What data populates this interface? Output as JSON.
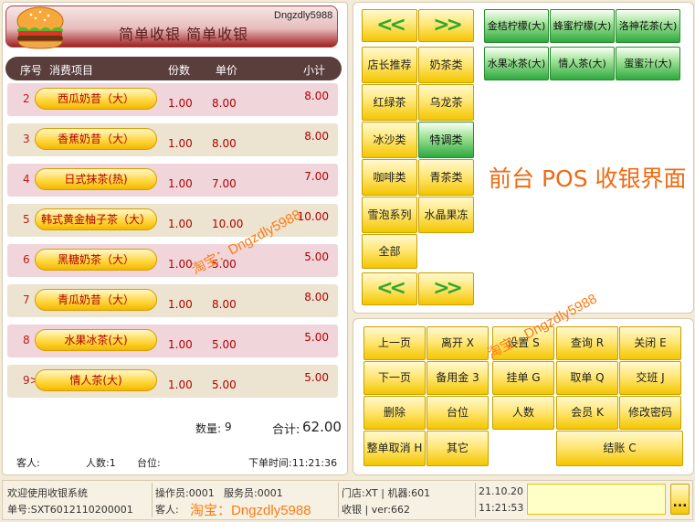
{
  "header": {
    "title": "简单收银  简单收银",
    "brand_tag": "Dngzdly5988",
    "logo_icon": "burger-icon"
  },
  "columns": {
    "no": "序号",
    "item": "消费项目",
    "qty": "份数",
    "price": "单价",
    "subtotal": "小计"
  },
  "order_items": [
    {
      "no": "2",
      "name": "西瓜奶昔（大）",
      "qty": "1.00",
      "price": "8.00",
      "subtotal": "8.00"
    },
    {
      "no": "3",
      "name": "香蕉奶昔（大）",
      "qty": "1.00",
      "price": "8.00",
      "subtotal": "8.00"
    },
    {
      "no": "4",
      "name": "日式抹茶(热)",
      "qty": "1.00",
      "price": "7.00",
      "subtotal": "7.00"
    },
    {
      "no": "5",
      "name": "韩式黄金柚子茶（大）",
      "qty": "1.00",
      "price": "10.00",
      "subtotal": "10.00"
    },
    {
      "no": "6",
      "name": "黑糖奶茶（大）",
      "qty": "1.00",
      "price": "5.00",
      "subtotal": "5.00"
    },
    {
      "no": "7",
      "name": "青瓜奶昔（大）",
      "qty": "1.00",
      "price": "8.00",
      "subtotal": "8.00"
    },
    {
      "no": "8",
      "name": "水果冰茶(大)",
      "qty": "1.00",
      "price": "5.00",
      "subtotal": "5.00"
    },
    {
      "no": "9>",
      "name": "情人茶(大)",
      "qty": "1.00",
      "price": "5.00",
      "subtotal": "5.00"
    }
  ],
  "summary": {
    "qty_label": "数量:",
    "qty": "9",
    "total_label": "合计:",
    "total": "62.00"
  },
  "footer": {
    "guest": "客人:",
    "people": "人数:1",
    "table": "台位:",
    "order_time": "下单时间:11:21:36"
  },
  "nav": {
    "prev": "<<",
    "next": ">>"
  },
  "categories": [
    "店长推荐",
    "奶茶类",
    "红绿茶",
    "乌龙茶",
    "冰沙类",
    "特调类",
    "咖啡类",
    "青茶类",
    "雪泡系列",
    "水晶果冻",
    "全部"
  ],
  "active_category": "特调类",
  "products": [
    "金桔柠檬(大)",
    "蜂蜜柠檬(大)",
    "洛神花茶(大)",
    "水果冰茶(大)",
    "情人茶(大)",
    "蛋蜜汁(大)"
  ],
  "pos_label": "前台 POS 收银界面",
  "functions": [
    [
      "上一页",
      "离开 X",
      "设置 S",
      "查询 R",
      "关闭 E"
    ],
    [
      "下一页",
      "备用金 3",
      "挂单 G",
      "取单 Q",
      "交班 J"
    ],
    [
      "删除",
      "台位",
      "人数",
      "会员 K",
      "修改密码"
    ],
    [
      "整单取消 H",
      "其它",
      "结账 C"
    ]
  ],
  "status": {
    "welcome": "欢迎使用收银系统",
    "order_no": "单号:SXT6012110200001",
    "operator": "操作员:0001",
    "waiter": "服务员:0001",
    "guest": "客人:",
    "store": "门店:XT | 机器:601",
    "mode": "收银 | ver:662",
    "date": "21.10.20",
    "time": "11:21:53",
    "more": "..."
  },
  "watermarks": [
    "淘宝：Dngzdly5988",
    "淘宝：Dngzdly5988",
    "淘宝：Dngzdly5988"
  ],
  "colors": {
    "accent_red": "#b00000",
    "button_yellow": "#ffe778",
    "button_green": "#2fa93e",
    "pos_orange": "#ef6a12"
  }
}
